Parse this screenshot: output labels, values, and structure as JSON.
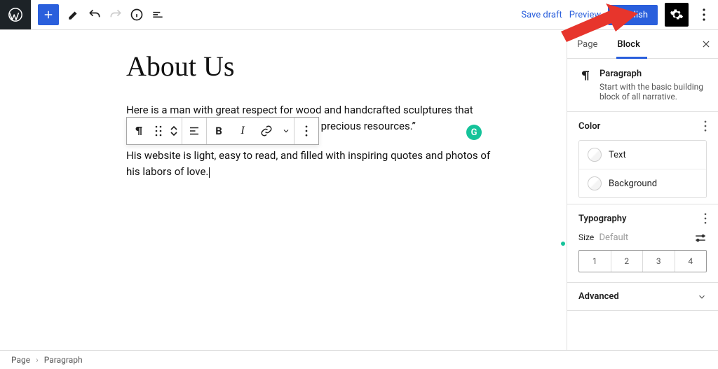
{
  "topbar": {
    "save_draft": "Save draft",
    "preview": "Preview",
    "publish": "Publish"
  },
  "content": {
    "title": "About Us",
    "p1": "Here is a man with great respect for wood and handcrafted sculptures that “tell a story about one of our earth’s most precious resources.”",
    "p2": "His website is light, easy to read, and filled with inspiring quotes and photos of his labors of love."
  },
  "grammarly": "G",
  "sidebar": {
    "tabs": {
      "page": "Page",
      "block": "Block"
    },
    "block": {
      "name": "Paragraph",
      "desc": "Start with the basic building block of all narrative."
    },
    "color": {
      "header": "Color",
      "text": "Text",
      "background": "Background"
    },
    "typography": {
      "header": "Typography",
      "size_label": "Size",
      "size_default": "Default",
      "presets": [
        "1",
        "2",
        "3",
        "4"
      ]
    },
    "advanced": {
      "header": "Advanced"
    }
  },
  "breadcrumb": {
    "root": "Page",
    "leaf": "Paragraph"
  }
}
